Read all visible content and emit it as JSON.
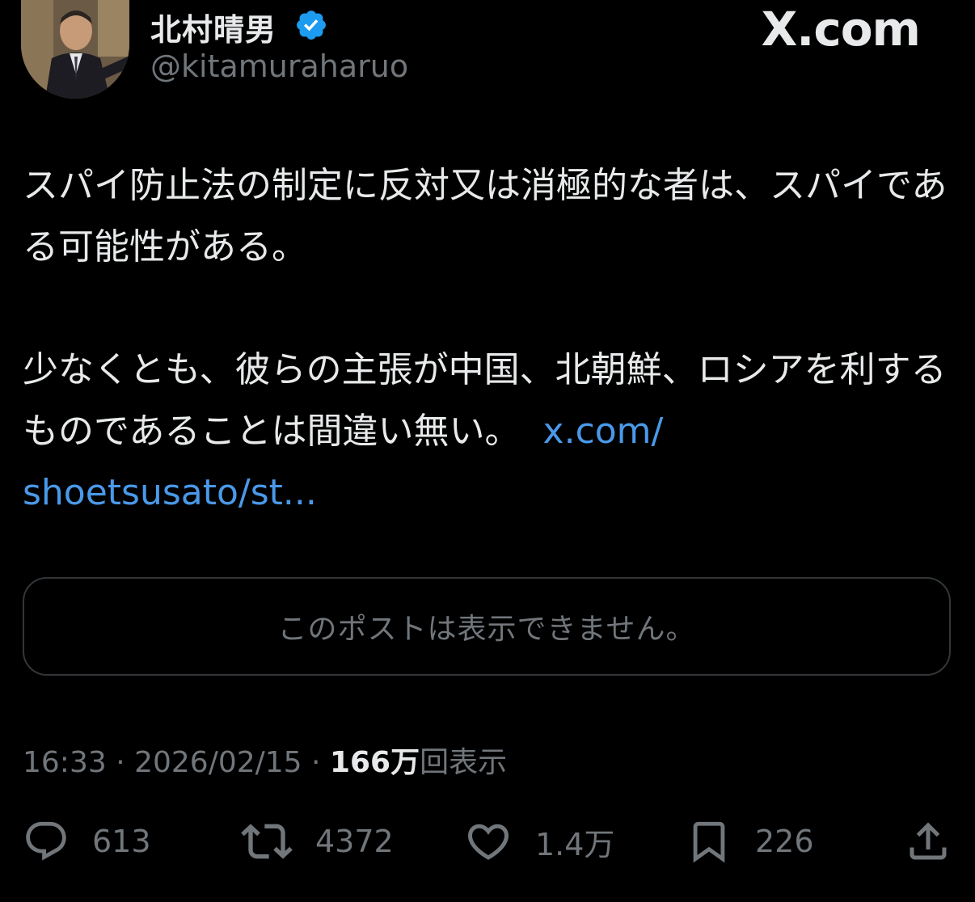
{
  "header": {
    "display_name": "北村晴男",
    "handle": "@kitamuraharuo",
    "brand": "X.com"
  },
  "tweet": {
    "paragraph1": "スパイ防止法の制定に反対又は消極的な者は、スパイである可能性がある。",
    "paragraph2_text": "少なくとも、彼らの主張が中国、北朝鮮、ロシアを利するものであることは間違い無い。",
    "link_part1": "x.com/",
    "link_part2": "shoetsusato/st..."
  },
  "quote_card": {
    "message": "このポストは表示できません。"
  },
  "meta": {
    "time": "16:33",
    "separator": " · ",
    "date": "2026/02/15",
    "views_count": "166万",
    "views_label": "回表示"
  },
  "actions": {
    "replies": "613",
    "reposts": "4372",
    "likes": "1.4万",
    "bookmarks": "226"
  },
  "colors": {
    "background": "#000000",
    "text": "#e7e9ea",
    "secondary": "#71767b",
    "link": "#4a99e9",
    "verified": "#1d9bf0",
    "border": "#333639"
  },
  "icons": [
    "avatar",
    "verified-badge-icon",
    "reply-icon",
    "repost-icon",
    "like-icon",
    "bookmark-icon",
    "share-icon"
  ]
}
